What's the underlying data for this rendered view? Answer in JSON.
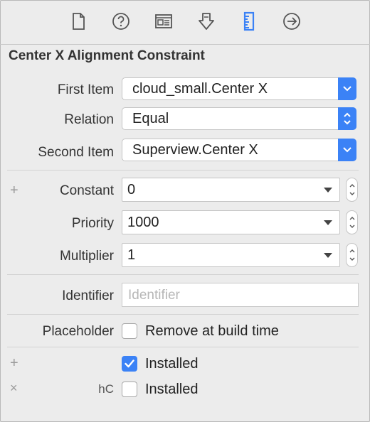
{
  "toolbar": {
    "tabs": [
      {
        "name": "file-inspector-icon"
      },
      {
        "name": "quick-help-icon"
      },
      {
        "name": "identity-inspector-icon"
      },
      {
        "name": "attributes-inspector-icon"
      },
      {
        "name": "size-inspector-icon",
        "selected": true
      },
      {
        "name": "connections-inspector-icon"
      }
    ],
    "accent": "#3b82f6"
  },
  "section_title": "Center X Alignment Constraint",
  "first_item": {
    "label": "First Item",
    "value": "cloud_small.Center X"
  },
  "relation": {
    "label": "Relation",
    "value": "Equal"
  },
  "second_item": {
    "label": "Second Item",
    "value": "Superview.Center X"
  },
  "constant": {
    "label": "Constant",
    "value": "0",
    "plus": "+"
  },
  "priority": {
    "label": "Priority",
    "value": "1000"
  },
  "multiplier": {
    "label": "Multiplier",
    "value": "1"
  },
  "identifier": {
    "label": "Identifier",
    "placeholder": "Identifier",
    "value": ""
  },
  "placeholder": {
    "label": "Placeholder",
    "checkbox_label": "Remove at build time",
    "checked": false
  },
  "installed": [
    {
      "prefix": "+",
      "size_class": "",
      "label": "Installed",
      "checked": true
    },
    {
      "prefix": "×",
      "size_class": "hC",
      "label": "Installed",
      "checked": false
    }
  ]
}
